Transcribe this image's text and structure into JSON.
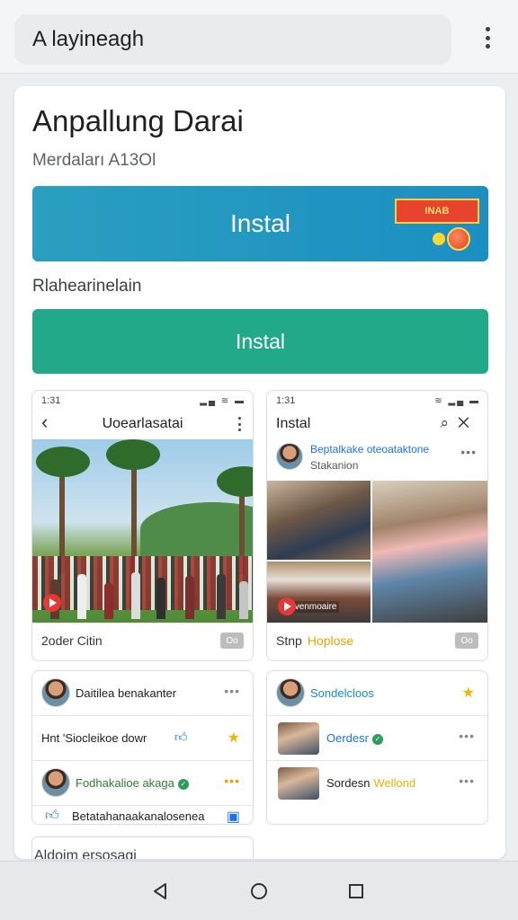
{
  "browser": {
    "address": "A layineagh"
  },
  "app": {
    "title": "Anpallung Darai",
    "subtitle": "Merdaları A13Ol",
    "primary_button": "Instal",
    "promo_badge": "INAB",
    "section_label": "Rlahearinelain",
    "secondary_button": "Instal"
  },
  "screenshots": {
    "left": {
      "time": "1:31",
      "title": "Uoearlasatai",
      "footer": "2oder Citin",
      "footer_badge": "Oo"
    },
    "right": {
      "time": "1:31",
      "title": "Instal",
      "post_name": "Beptalkake oteoataktone",
      "post_sub": "Stakanion",
      "photo_caption": "Ovenmoaire",
      "footer": "Stnp",
      "footer_highlight": "Hoplose",
      "footer_badge": "Oo"
    }
  },
  "list_left": {
    "rows": [
      {
        "text": "Daitilea benakanter"
      },
      {
        "text": "Hnt 'Siocleikoe dowr"
      },
      {
        "text": "Fodhakalioe akaga"
      },
      {
        "text": "Betatahanaakanalosenea"
      }
    ]
  },
  "list_right": {
    "rows": [
      {
        "text": "Sondelcloos"
      },
      {
        "text": "Oerdesr"
      },
      {
        "text": "Sordesn",
        "highlight": "Wellond"
      }
    ]
  },
  "bottom_card": {
    "text": "Aldoim ersosagi"
  },
  "colors": {
    "install_blue": "#1b8fc2",
    "install_green": "#22a98a",
    "accent_star": "#f4b400"
  },
  "icons": [
    "more-vert-icon",
    "back-arrow-icon",
    "search-icon",
    "close-icon",
    "star-icon",
    "thumbs-up-icon",
    "play-icon",
    "nav-back-icon",
    "nav-home-icon",
    "nav-recent-icon"
  ]
}
